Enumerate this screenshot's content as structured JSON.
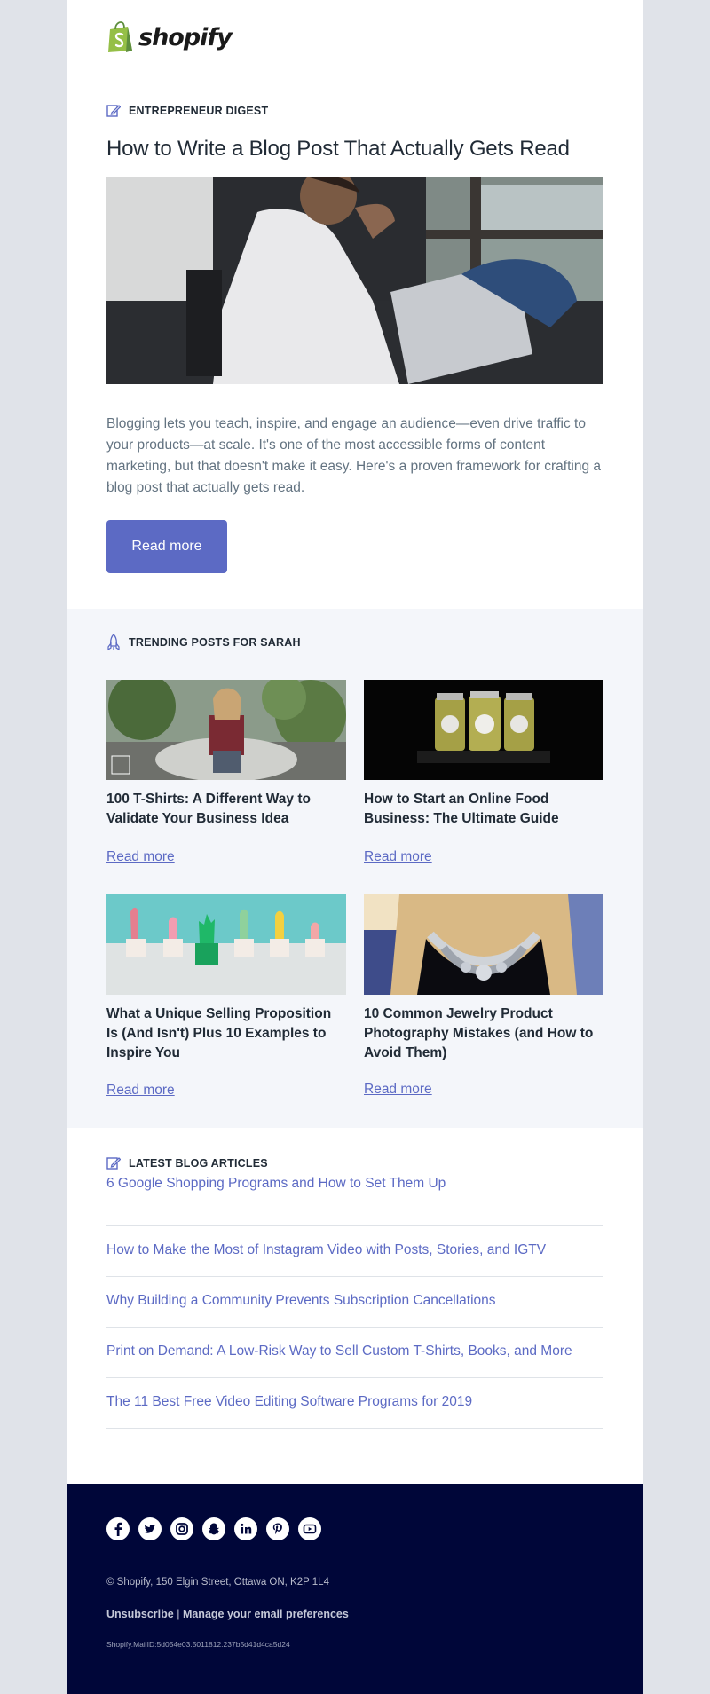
{
  "brand": {
    "name": "shopify",
    "color": "#95bf47"
  },
  "colors": {
    "accent": "#5c6ac4",
    "footer_bg": "#000639",
    "section_bg": "#f4f6fa"
  },
  "digest": {
    "section_label": "ENTREPRENEUR DIGEST",
    "section_icon": "edit-icon",
    "title": "How to Write a Blog Post That Actually Gets Read",
    "hero_image": "man-with-laptop-by-window",
    "intro": "Blogging lets you teach, inspire, and engage an audience—even drive traffic to your products—at scale. It's one of the most accessible forms of content marketing, but that doesn't make it easy. Here's a proven framework for crafting a blog post that actually gets read.",
    "button_label": "Read more"
  },
  "trending": {
    "section_label": "TRENDING POSTS FOR SARAH",
    "section_icon": "rocket-icon",
    "cards": [
      {
        "title": "100 T-Shirts: A Different Way to Validate Your Business Idea",
        "link": "Read more",
        "image": "woman-in-tshirt-on-car"
      },
      {
        "title": "How to Start an Online Food Business: The Ultimate Guide",
        "link": "Read more",
        "image": "pickle-jars"
      },
      {
        "title": "What a Unique Selling Proposition Is (And Isn't) Plus 10 Examples to Inspire You",
        "link": "Read more",
        "image": "paper-cactus-row"
      },
      {
        "title": "10 Common Jewelry Product Photography Mistakes (and How to Avoid Them)",
        "link": "Read more",
        "image": "statement-necklace"
      }
    ]
  },
  "latest": {
    "section_label": "LATEST BLOG ARTICLES",
    "section_icon": "edit-icon",
    "items": [
      "6 Google Shopping Programs and How to Set Them Up",
      "How to Make the Most of Instagram Video with Posts, Stories, and IGTV",
      "Why Building a Community Prevents Subscription Cancellations",
      "Print on Demand: A Low-Risk Way to Sell Custom T-Shirts, Books, and More",
      "The 11 Best Free Video Editing Software Programs for 2019"
    ]
  },
  "footer": {
    "social": [
      "facebook-icon",
      "twitter-icon",
      "instagram-icon",
      "snapchat-icon",
      "linkedin-icon",
      "pinterest-icon",
      "youtube-icon"
    ],
    "address": "© Shopify,  150 Elgin Street, Ottawa ON, K2P 1L4",
    "unsubscribe": "Unsubscribe",
    "separator": "|",
    "manage": "Manage your email preferences",
    "mail_id": "Shopify.MailID:5d054e03.5011812.237b5d41d4ca5d24"
  }
}
